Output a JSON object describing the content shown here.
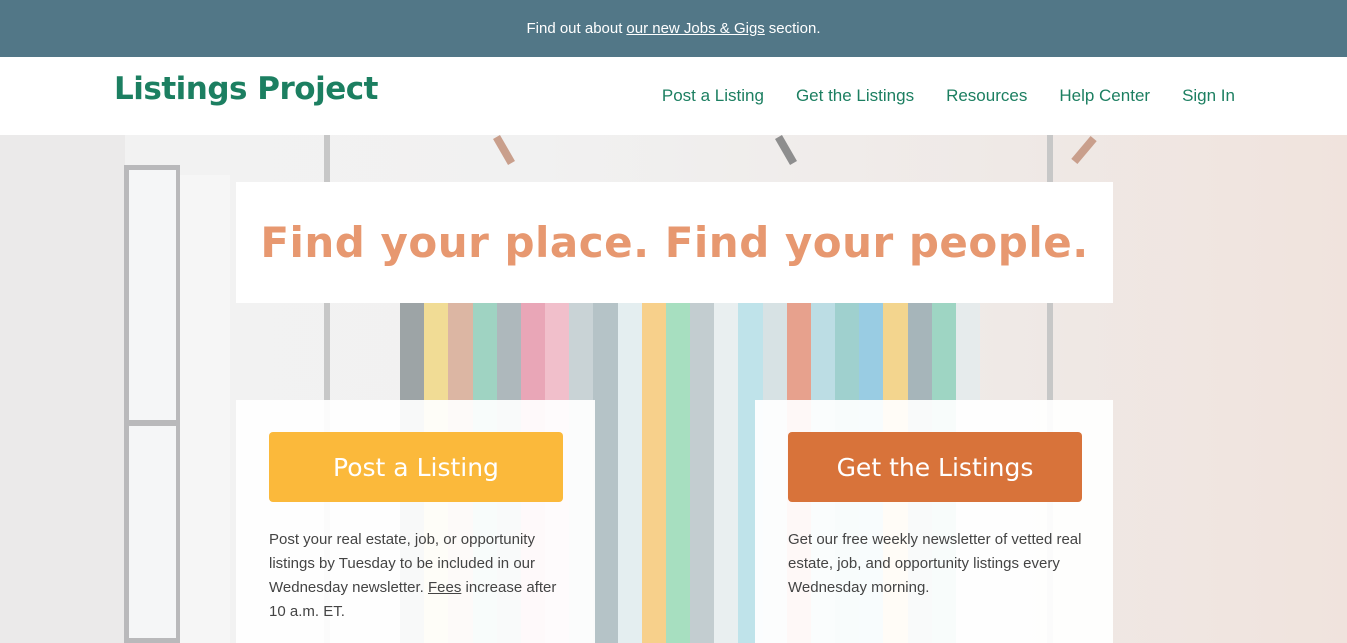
{
  "announcement": {
    "prefix": "Find out about",
    "link": "our new Jobs & Gigs",
    "suffix": "section."
  },
  "header": {
    "logo": "Listings Project",
    "nav": [
      "Post a Listing",
      "Get the Listings",
      "Resources",
      "Help Center",
      "Sign In"
    ]
  },
  "hero": {
    "headline": "Find your place. Find your people."
  },
  "cards": {
    "post": {
      "button": "Post a Listing",
      "text_before": "Post your real estate, job, or opportunity listings by Tuesday to be included in our Wednesday newsletter.",
      "link": "Fees",
      "text_after": "increase after 10 a.m. ET."
    },
    "get": {
      "button": "Get the Listings",
      "text": "Get our free weekly newsletter of vetted real estate, job, and opportunity listings every Wednesday morning."
    }
  },
  "colors": {
    "announcement_bg": "#527787",
    "brand_green": "#1c7f61",
    "headline": "#e79870",
    "post_button": "#fbb93b",
    "get_button": "#d8733a"
  }
}
